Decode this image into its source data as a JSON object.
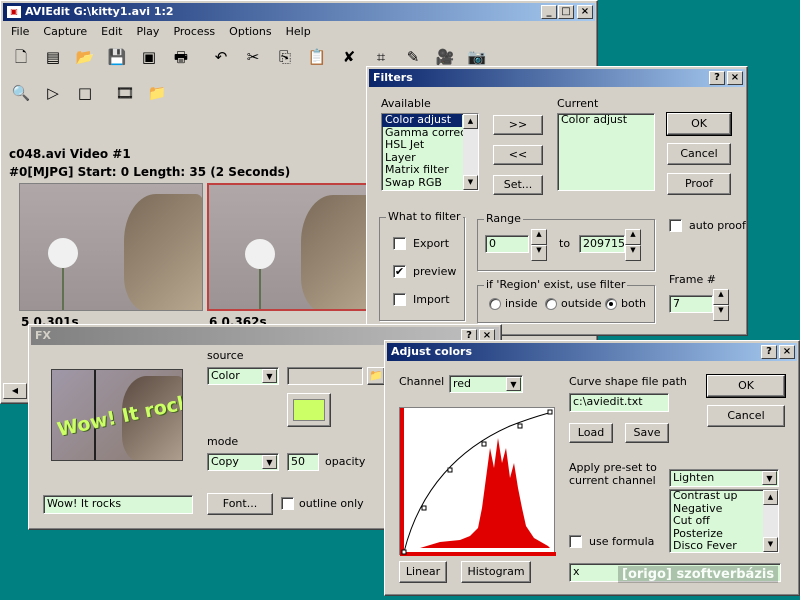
{
  "main": {
    "title": "AVIEdit G:\\kitty1.avi  1:2",
    "menu": [
      "File",
      "Capture",
      "Edit",
      "Play",
      "Process",
      "Options",
      "Help"
    ],
    "toolbar1": [
      {
        "icon": "new-icon",
        "g": "🗋"
      },
      {
        "icon": "bmp-icon",
        "g": "▤"
      },
      {
        "icon": "open-icon",
        "g": "📂"
      },
      {
        "icon": "save-icon",
        "g": "💾"
      },
      {
        "icon": "export-icon",
        "g": "▣"
      },
      {
        "icon": "print-icon",
        "g": "🖶"
      },
      {
        "icon": "undo-icon",
        "g": "↶"
      },
      {
        "icon": "cut-icon",
        "g": "✂"
      },
      {
        "icon": "copy-icon",
        "g": "⎘"
      },
      {
        "icon": "paste-icon",
        "g": "📋"
      },
      {
        "icon": "delete-icon",
        "g": "✘"
      },
      {
        "icon": "crop-icon",
        "g": "⌗"
      },
      {
        "icon": "pencil-icon",
        "g": "✎"
      },
      {
        "icon": "video-camera-icon",
        "g": "🎥"
      },
      {
        "icon": "camera-icon",
        "g": "📷"
      }
    ],
    "toolbar2": [
      {
        "icon": "magnifier-icon",
        "g": "🔍"
      },
      {
        "icon": "play-icon",
        "g": "▷"
      },
      {
        "icon": "stop-icon",
        "g": "□"
      },
      {
        "icon": "filmstrip-icon",
        "g": "🎞"
      },
      {
        "icon": "folder-icon",
        "g": "📁"
      }
    ],
    "video_title": "c048.avi Video #1",
    "video_info": "#0[MJPG] Start: 0 Length: 35 (2 Seconds)",
    "frame1_label": "5  0.301s",
    "frame2_label": "6  0.362s"
  },
  "filters": {
    "title": "Filters",
    "available_label": "Available",
    "current_label": "Current",
    "available": [
      "Color adjust",
      "Gamma correction",
      "HSL Jet",
      "Layer",
      "Matrix filter",
      "Swap RGB"
    ],
    "current": [
      "Color adjust"
    ],
    "add_btn": ">>",
    "remove_btn": "<<",
    "set_btn": "Set...",
    "ok": "OK",
    "cancel": "Cancel",
    "proof": "Proof",
    "auto_proof": "auto proof",
    "what_to_filter": "What to filter",
    "export": "Export",
    "preview": "preview",
    "import": "Import",
    "range": "Range",
    "range_from": "0",
    "to": "to",
    "range_to": "209715",
    "region_label": "if 'Region' exist, use filter",
    "inside": "inside",
    "outside": "outside",
    "both": "both",
    "frame_label": "Frame #",
    "frame_value": "7"
  },
  "fx": {
    "title": "FX",
    "source_label": "source",
    "source_value": "Color",
    "mode_label": "mode",
    "mode_value": "Copy",
    "opacity_value": "50",
    "opacity_label": "opacity",
    "text_value": "Wow! It rocks",
    "font_btn": "Font...",
    "outline_only": "outline only",
    "preview_text": "Wow! It rocks",
    "color": "#ccff66"
  },
  "adjust": {
    "title": "Adjust colors",
    "channel_label": "Channel",
    "channel_value": "red",
    "curve_label": "Curve shape file path",
    "curve_path": "c:\\aviedit.txt",
    "load": "Load",
    "save": "Save",
    "ok": "OK",
    "cancel": "Cancel",
    "preset_label": "Apply pre-set to current channel",
    "preset_value": "Lighten",
    "presets": [
      "Contrast up",
      "Negative",
      "Cut off",
      "Posterize",
      "Disco Fever"
    ],
    "use_formula": "use formula",
    "formula_value": "x",
    "linear": "Linear",
    "histogram": "Histogram"
  },
  "watermark": "[origo] szoftverbázis"
}
